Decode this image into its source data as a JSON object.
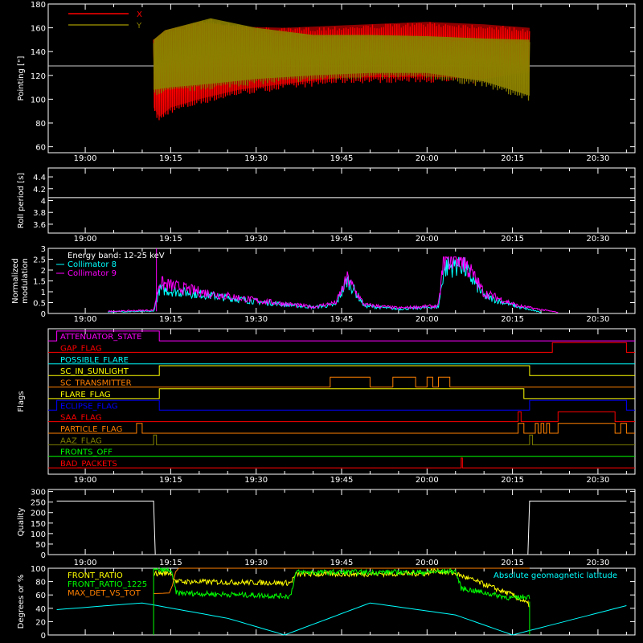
{
  "chart_data": [
    {
      "id": "pointing",
      "type": "line",
      "ylabel": "Pointing [\"]",
      "ylim": [
        55,
        180
      ],
      "yticks": [
        60,
        80,
        100,
        120,
        140,
        160,
        180
      ],
      "xticks": [
        "19:00",
        "19:15",
        "19:30",
        "19:45",
        "20:00",
        "20:15",
        "20:30"
      ],
      "reference_line": 128,
      "series": [
        {
          "name": "X",
          "color": "#ff0000",
          "x_start": "19:12",
          "x_end": "20:18",
          "upper": [
            {
              "t": "19:12",
              "v": 150
            },
            {
              "t": "19:14",
              "v": 158
            },
            {
              "t": "19:20",
              "v": 165
            },
            {
              "t": "19:27",
              "v": 161
            },
            {
              "t": "19:35",
              "v": 160
            },
            {
              "t": "19:45",
              "v": 162
            },
            {
              "t": "20:00",
              "v": 165
            },
            {
              "t": "20:10",
              "v": 163
            },
            {
              "t": "20:18",
              "v": 160
            }
          ],
          "lower": [
            {
              "t": "19:12",
              "v": 88
            },
            {
              "t": "19:13",
              "v": 80
            },
            {
              "t": "19:15",
              "v": 88
            },
            {
              "t": "19:20",
              "v": 95
            },
            {
              "t": "19:27",
              "v": 103
            },
            {
              "t": "19:35",
              "v": 108
            },
            {
              "t": "19:45",
              "v": 113
            },
            {
              "t": "20:00",
              "v": 114
            },
            {
              "t": "20:10",
              "v": 112
            },
            {
              "t": "20:18",
              "v": 118
            }
          ]
        },
        {
          "name": "Y",
          "color": "#8b8000",
          "x_start": "19:12",
          "x_end": "20:18",
          "upper": [
            {
              "t": "19:12",
              "v": 150
            },
            {
              "t": "19:14",
              "v": 158
            },
            {
              "t": "19:22",
              "v": 168
            },
            {
              "t": "19:30",
              "v": 160
            },
            {
              "t": "19:40",
              "v": 154
            },
            {
              "t": "19:50",
              "v": 154
            },
            {
              "t": "20:00",
              "v": 153
            },
            {
              "t": "20:10",
              "v": 151
            },
            {
              "t": "20:18",
              "v": 150
            }
          ],
          "lower": [
            {
              "t": "19:12",
              "v": 103
            },
            {
              "t": "19:15",
              "v": 105
            },
            {
              "t": "19:22",
              "v": 108
            },
            {
              "t": "19:30",
              "v": 112
            },
            {
              "t": "19:40",
              "v": 115
            },
            {
              "t": "19:50",
              "v": 117
            },
            {
              "t": "20:00",
              "v": 117
            },
            {
              "t": "20:10",
              "v": 110
            },
            {
              "t": "20:18",
              "v": 98
            }
          ]
        }
      ]
    },
    {
      "id": "roll",
      "type": "line",
      "ylabel": "Roll period [s]",
      "ylim": [
        3.45,
        4.55
      ],
      "yticks": [
        3.6,
        3.8,
        4.0,
        4.2,
        4.4
      ],
      "xticks": [
        "19:00",
        "19:15",
        "19:30",
        "19:45",
        "20:00",
        "20:15",
        "20:30"
      ],
      "series": [
        {
          "name": "",
          "color": "#ffffff",
          "y": 4.05
        }
      ]
    },
    {
      "id": "modulation",
      "type": "line",
      "ylabel": "Normalized modulation",
      "ylim": [
        0,
        3.0
      ],
      "yticks": [
        0.0,
        0.5,
        1.0,
        1.5,
        2.0,
        2.5,
        3.0
      ],
      "xticks": [
        "19:00",
        "19:15",
        "19:30",
        "19:45",
        "20:00",
        "20:15",
        "20:30"
      ],
      "legend": [
        "Energy band: 12-25 keV",
        "Collimator 8",
        "Collimator 9"
      ],
      "series": [
        {
          "name": "Collimator 8",
          "color": "#00ffff",
          "points": [
            {
              "t": "19:04",
              "v": 0.08
            },
            {
              "t": "19:12",
              "v": 0.1
            },
            {
              "t": "19:13",
              "v": 1.1
            },
            {
              "t": "19:20",
              "v": 0.9
            },
            {
              "t": "19:30",
              "v": 0.55
            },
            {
              "t": "19:40",
              "v": 0.28
            },
            {
              "t": "19:44",
              "v": 0.4
            },
            {
              "t": "19:46",
              "v": 1.55
            },
            {
              "t": "19:49",
              "v": 0.35
            },
            {
              "t": "19:55",
              "v": 0.2
            },
            {
              "t": "20:02",
              "v": 0.3
            },
            {
              "t": "20:03",
              "v": 2.1
            },
            {
              "t": "20:06",
              "v": 2.3
            },
            {
              "t": "20:10",
              "v": 0.8
            },
            {
              "t": "20:16",
              "v": 0.3
            },
            {
              "t": "20:20",
              "v": 0.05
            }
          ]
        },
        {
          "name": "Collimator 9",
          "color": "#ff00ff",
          "points": [
            {
              "t": "19:04",
              "v": 0.1
            },
            {
              "t": "19:12",
              "v": 0.15
            },
            {
              "t": "19:13",
              "v": 1.4
            },
            {
              "t": "19:20",
              "v": 1.0
            },
            {
              "t": "19:30",
              "v": 0.6
            },
            {
              "t": "19:40",
              "v": 0.3
            },
            {
              "t": "19:44",
              "v": 0.5
            },
            {
              "t": "19:46",
              "v": 1.6
            },
            {
              "t": "19:49",
              "v": 0.4
            },
            {
              "t": "19:55",
              "v": 0.25
            },
            {
              "t": "20:02",
              "v": 0.35
            },
            {
              "t": "20:03",
              "v": 2.6
            },
            {
              "t": "20:06",
              "v": 2.6
            },
            {
              "t": "20:10",
              "v": 0.95
            },
            {
              "t": "20:16",
              "v": 0.35
            },
            {
              "t": "20:23",
              "v": 0.05
            }
          ]
        }
      ]
    },
    {
      "id": "flags",
      "type": "line",
      "ylabel": "Flags",
      "xticks": [
        "19:00",
        "19:15",
        "19:30",
        "19:45",
        "20:00",
        "20:15",
        "20:30"
      ],
      "series": [
        {
          "name": "ATTENUATOR_STATE",
          "color": "#ff00ff",
          "high": [
            [
              "18:55",
              "19:13"
            ]
          ]
        },
        {
          "name": "GAP_FLAG",
          "color": "#ff0000",
          "high": [
            [
              "20:22",
              "20:35"
            ]
          ]
        },
        {
          "name": "POSSIBLE_FLARE",
          "color": "#00ffff",
          "high": []
        },
        {
          "name": "SC_IN_SUNLIGHT",
          "color": "#ffff00",
          "high": [
            [
              "19:13",
              "20:18"
            ]
          ]
        },
        {
          "name": "SC_TRANSMITTER",
          "color": "#ff8000",
          "high": [
            [
              "19:43",
              "19:50"
            ],
            [
              "19:54",
              "19:58"
            ],
            [
              "20:00",
              "20:01"
            ],
            [
              "20:02",
              "20:04"
            ]
          ]
        },
        {
          "name": "FLARE_FLAG",
          "color": "#ffff00",
          "high": [
            [
              "19:13",
              "20:17"
            ]
          ]
        },
        {
          "name": "ECLIPSE_FLAG",
          "color": "#0000ff",
          "high": [
            [
              "18:55",
              "19:13"
            ],
            [
              "20:18",
              "20:35"
            ]
          ]
        },
        {
          "name": "SAA_FLAG",
          "color": "#ff0000",
          "high": [
            [
              "20:16",
              "20:16.5"
            ],
            [
              "20:23",
              "20:33"
            ]
          ]
        },
        {
          "name": "PARTICLE_FLAG",
          "color": "#ff8000",
          "high": [
            [
              "19:09",
              "19:10"
            ],
            [
              "20:16",
              "20:17"
            ],
            [
              "20:19",
              "20:19.5"
            ],
            [
              "20:20",
              "20:20.5"
            ],
            [
              "20:21",
              "20:21.5"
            ],
            [
              "20:23",
              "20:33"
            ],
            [
              "20:34",
              "20:35"
            ]
          ]
        },
        {
          "name": "AAZ_FLAG",
          "color": "#808000",
          "high": [
            [
              "19:12",
              "19:12.5"
            ],
            [
              "20:18",
              "20:18.5"
            ]
          ]
        },
        {
          "name": "FRONTS_OFF",
          "color": "#00ff00",
          "high": []
        },
        {
          "name": "BAD_PACKETS",
          "color": "#ff0000",
          "high": [
            [
              "20:06",
              "20:06.2"
            ]
          ]
        }
      ]
    },
    {
      "id": "quality",
      "type": "line",
      "ylabel": "Quality",
      "ylim": [
        0,
        310
      ],
      "yticks": [
        0,
        50,
        100,
        150,
        200,
        250,
        300
      ],
      "xticks": [
        "19:00",
        "19:15",
        "19:30",
        "19:45",
        "20:00",
        "20:15",
        "20:30"
      ],
      "series": [
        {
          "name": "",
          "color": "#ffffff",
          "points": [
            {
              "t": "18:55",
              "v": 255
            },
            {
              "t": "19:12",
              "v": 255
            },
            {
              "t": "19:12.3",
              "v": 0
            },
            {
              "t": "20:17.7",
              "v": 0
            },
            {
              "t": "20:18",
              "v": 255
            },
            {
              "t": "20:35",
              "v": 255
            }
          ]
        }
      ]
    },
    {
      "id": "ratios",
      "type": "line",
      "ylabel": "Degrees or %",
      "ylim": [
        0,
        100
      ],
      "yticks": [
        0,
        20,
        40,
        60,
        80,
        100
      ],
      "legend_right": "Absolute geomagnetic latitude",
      "series": [
        {
          "name": "FRONT_RATIO",
          "color": "#ffff00",
          "points": [
            {
              "t": "19:12",
              "v": 92
            },
            {
              "t": "19:15",
              "v": 93
            },
            {
              "t": "19:16",
              "v": 80
            },
            {
              "t": "19:36",
              "v": 78
            },
            {
              "t": "19:37",
              "v": 91
            },
            {
              "t": "20:00",
              "v": 92
            },
            {
              "t": "20:01",
              "v": 97
            },
            {
              "t": "20:05",
              "v": 92
            },
            {
              "t": "20:15",
              "v": 60
            },
            {
              "t": "20:18",
              "v": 45
            }
          ]
        },
        {
          "name": "FRONT_RATIO_1225",
          "color": "#00ff00",
          "points": [
            {
              "t": "19:12",
              "v": 97
            },
            {
              "t": "19:15",
              "v": 97
            },
            {
              "t": "19:16",
              "v": 63
            },
            {
              "t": "19:36",
              "v": 58
            },
            {
              "t": "19:37",
              "v": 94
            },
            {
              "t": "20:00",
              "v": 94
            },
            {
              "t": "20:05",
              "v": 96
            },
            {
              "t": "20:06",
              "v": 70
            },
            {
              "t": "20:15",
              "v": 55
            },
            {
              "t": "20:18",
              "v": 58
            }
          ]
        },
        {
          "name": "MAX_DET_VS_TOT",
          "color": "#ff8000",
          "points": [
            {
              "t": "19:12",
              "v": 62
            },
            {
              "t": "19:15",
              "v": 63
            },
            {
              "t": "19:16",
              "v": 100
            },
            {
              "t": "19:36",
              "v": 100
            },
            {
              "t": "20:15",
              "v": 100
            },
            {
              "t": "20:18",
              "v": 100
            }
          ]
        },
        {
          "name": "Absolute geomagnetic latitude",
          "color": "#00ffff",
          "points": [
            {
              "t": "18:55",
              "v": 38
            },
            {
              "t": "19:10",
              "v": 48
            },
            {
              "t": "19:25",
              "v": 25
            },
            {
              "t": "19:35",
              "v": 0
            },
            {
              "t": "19:50",
              "v": 48
            },
            {
              "t": "20:05",
              "v": 30
            },
            {
              "t": "20:15",
              "v": 0
            },
            {
              "t": "20:35",
              "v": 44
            }
          ]
        }
      ]
    }
  ]
}
